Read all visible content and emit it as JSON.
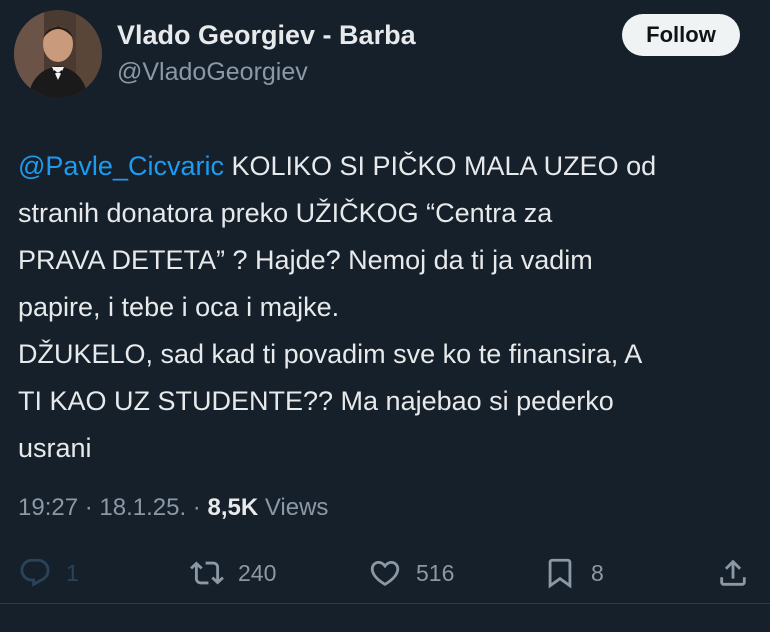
{
  "author": {
    "display_name": "Vlado Georgiev - Barba",
    "handle": "@VladoGeorgiev"
  },
  "follow_button": {
    "label": "Follow"
  },
  "tweet": {
    "mention": "@Pavle_Cicvaric",
    "line1_rest": " KOLIKO SI PIČKO MALA UZEO od",
    "line2": "stranih donatora preko UŽIČKOG “Centra za",
    "line3": "PRAVA DETETA” ? Hajde?  Nemoj da ti ja vadim",
    "line4": "papire, i tebe i oca i majke.",
    "line5": "DŽUKELO, sad kad ti povadim sve ko te finansira, A",
    "line6": "TI KAO UZ STUDENTE?? Ma najebao si pederko",
    "line7": "usrani"
  },
  "meta": {
    "time": "19:27",
    "sep1": " · ",
    "date": "18.1.25.",
    "sep2": " · ",
    "views_count": "8,5K",
    "views_label": " Views"
  },
  "actions": {
    "replies": "1",
    "reposts": "240",
    "likes": "516",
    "bookmarks": "8"
  },
  "icons": {
    "reply": "reply-icon",
    "repost": "repost-icon",
    "like": "heart-icon",
    "bookmark": "bookmark-icon",
    "share": "share-icon"
  },
  "colors": {
    "background": "#15202b",
    "text": "#e7e9ea",
    "secondary": "#8b98a5",
    "link": "#1d9bf0",
    "follow_bg": "#eff3f4"
  }
}
